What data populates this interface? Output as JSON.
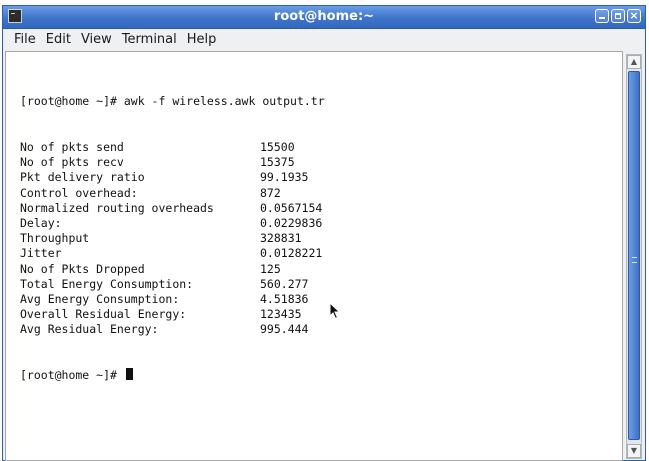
{
  "window": {
    "title": "root@home:~"
  },
  "menubar": {
    "items": [
      "File",
      "Edit",
      "View",
      "Terminal",
      "Help"
    ]
  },
  "terminal": {
    "command_line": "[root@home ~]# awk -f wireless.awk output.tr",
    "rows": [
      {
        "label": "No of pkts send",
        "value": "15500"
      },
      {
        "label": "No of pkts recv",
        "value": "15375"
      },
      {
        "label": "Pkt delivery ratio",
        "value": "99.1935"
      },
      {
        "label": "Control overhead:",
        "value": "872"
      },
      {
        "label": "Normalized routing overheads",
        "value": "0.0567154"
      },
      {
        "label": "Delay:",
        "value": "0.0229836"
      },
      {
        "label": "Throughput",
        "value": "328831"
      },
      {
        "label": "Jitter",
        "value": "0.0128221"
      },
      {
        "label": "No of Pkts Dropped",
        "value": "125"
      },
      {
        "label": "Total Energy Consumption:",
        "value": "560.277"
      },
      {
        "label": "Avg Energy Consumption:",
        "value": "4.51836"
      },
      {
        "label": "Overall Residual Energy:",
        "value": "123435"
      },
      {
        "label": "Avg Residual Energy:",
        "value": "995.444"
      }
    ],
    "prompt": "[root@home ~]# "
  },
  "colors": {
    "titlebar": "#3f74c9",
    "scroll_thumb": "#3d71c8",
    "background": "#ffffff"
  },
  "icons": [
    "terminal-app-icon",
    "minimize-icon",
    "maximize-icon",
    "close-icon",
    "mouse-pointer-icon"
  ]
}
